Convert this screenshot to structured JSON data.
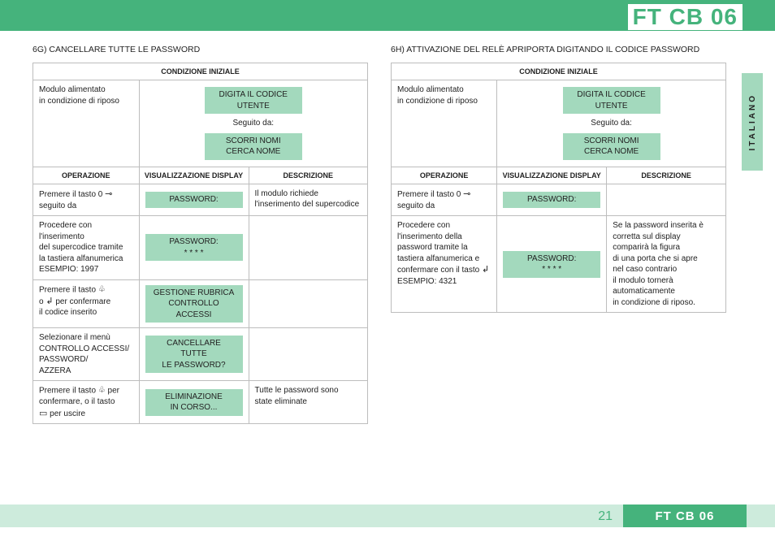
{
  "title": "FT CB 06",
  "side_tab": "ITALIANO",
  "page_number": "21",
  "footer_label": "FT CB 06",
  "icons": {
    "key": "⊸",
    "bell": "♧",
    "enter": "↲",
    "book": "▭"
  },
  "left": {
    "heading": "6G) CANCELLARE TUTTE LE PASSWORD",
    "initial_title": "CONDIZIONE INIZIALE",
    "initial_left": "Modulo alimentato\nin condizione di riposo",
    "initial_chip1a": "DIGITA IL CODICE",
    "initial_chip1b": "UTENTE",
    "initial_mid": "Seguito da:",
    "initial_chip2a": "SCORRI NOMI",
    "initial_chip2b": "CERCA NOME",
    "hdr_op": "OPERAZIONE",
    "hdr_disp": "VISUALIZZAZIONE DISPLAY",
    "hdr_desc": "DESCRIZIONE",
    "rows": [
      {
        "op_pre": "Premere il tasto 0",
        "op_post": "seguito da ",
        "op_icon": "key",
        "disp": "PASSWORD:",
        "desc": "Il modulo richiede\nl'inserimento del supercodice"
      },
      {
        "op": "Procedere con l'inserimento\ndel supercodice tramite\nla tastiera alfanumerica\nESEMPIO: 1997",
        "disp": "PASSWORD:\n* * * *",
        "desc": ""
      },
      {
        "op_pre": "Premere il tasto ",
        "op_icon": "bell",
        "op_post2": "o ",
        "op_icon2": "enter",
        "op_post3": " per confermare\nil codice inserito",
        "disp": "GESTIONE RUBRICA\nCONTROLLO ACCESSI",
        "desc": ""
      },
      {
        "op": "Selezionare il menù\nCONTROLLO ACCESSI/\nPASSWORD/\nAZZERA",
        "disp": "CANCELLARE TUTTE\nLE PASSWORD?",
        "desc": ""
      },
      {
        "op_pre": "Premere il tasto ",
        "op_icon": "bell",
        "op_mid": " per\nconfermare, o il tasto\n",
        "op_icon2": "book",
        "op_post3": " per uscire",
        "disp": "ELIMINAZIONE\nIN CORSO...",
        "desc": "Tutte le password sono\nstate eliminate"
      }
    ]
  },
  "right": {
    "heading": "6H) ATTIVAZIONE DEL RELÈ APRIPORTA DIGITANDO IL CODICE PASSWORD",
    "initial_title": "CONDIZIONE INIZIALE",
    "initial_left": "Modulo alimentato\nin condizione di riposo",
    "initial_chip1a": "DIGITA IL CODICE",
    "initial_chip1b": "UTENTE",
    "initial_mid": "Seguito da:",
    "initial_chip2a": "SCORRI NOMI",
    "initial_chip2b": "CERCA NOME",
    "hdr_op": "OPERAZIONE",
    "hdr_disp": "VISUALIZZAZIONE DISPLAY",
    "hdr_desc": "DESCRIZIONE",
    "rows": [
      {
        "op_pre": "Premere il tasto 0",
        "op_post": "seguito da ",
        "op_icon": "key",
        "disp": "PASSWORD:",
        "desc": ""
      },
      {
        "op_pre": "Procedere con\nl'inserimento della\npassword tramite la\ntastiera alfanumerica e\nconfermare con il tasto ",
        "op_icon": "enter",
        "op_post3": "\nESEMPIO: 4321",
        "disp": "PASSWORD:\n* * * *",
        "desc": "Se la password inserita è\ncorretta sul display\ncomparirà la figura\ndi una porta che si apre\nnel caso contrario\nil modulo tornerà\nautomaticamente\nin condizione di riposo."
      }
    ]
  }
}
